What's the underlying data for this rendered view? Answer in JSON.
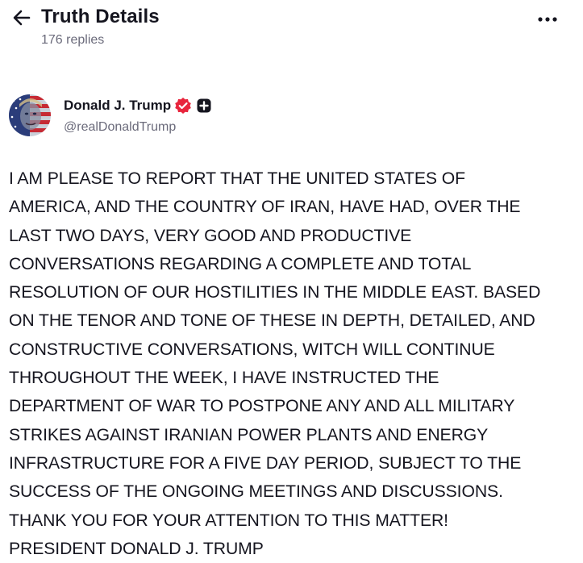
{
  "header": {
    "title": "Truth Details",
    "replies": "176 replies"
  },
  "author": {
    "name": "Donald J. Trump",
    "handle": "@realDonaldTrump"
  },
  "post": {
    "lines": [
      "I AM PLEASE TO REPORT THAT THE UNITED STATES OF",
      "AMERICA, AND THE COUNTRY OF IRAN, HAVE HAD, OVER THE",
      "LAST TWO DAYS, VERY GOOD AND PRODUCTIVE",
      "CONVERSATIONS REGARDING A COMPLETE AND TOTAL",
      "RESOLUTION OF OUR HOSTILITIES IN THE MIDDLE EAST. BASED",
      "ON THE TENOR AND TONE OF THESE IN DEPTH, DETAILED, AND",
      "CONSTRUCTIVE CONVERSATIONS, WITCH WILL CONTINUE",
      "THROUGHOUT THE WEEK, I HAVE INSTRUCTED THE",
      "DEPARTMENT OF WAR TO POSTPONE ANY AND ALL MILITARY",
      "STRIKES AGAINST IRANIAN POWER PLANTS AND ENERGY",
      "INFRASTRUCTURE FOR A FIVE DAY PERIOD, SUBJECT TO THE",
      "SUCCESS OF THE ONGOING MEETINGS AND DISCUSSIONS.",
      "THANK YOU FOR YOUR ATTENTION TO THIS MATTER!",
      "PRESIDENT DONALD J. TRUMP"
    ]
  },
  "icons": {
    "back": "arrow-left-icon",
    "more": "more-horizontal-icon",
    "verified": "verified-badge-icon",
    "plus": "plus-badge-icon"
  },
  "colors": {
    "verified_badge": "#e8243c",
    "text_primary": "#15151f",
    "text_secondary": "#6b6b7b"
  }
}
